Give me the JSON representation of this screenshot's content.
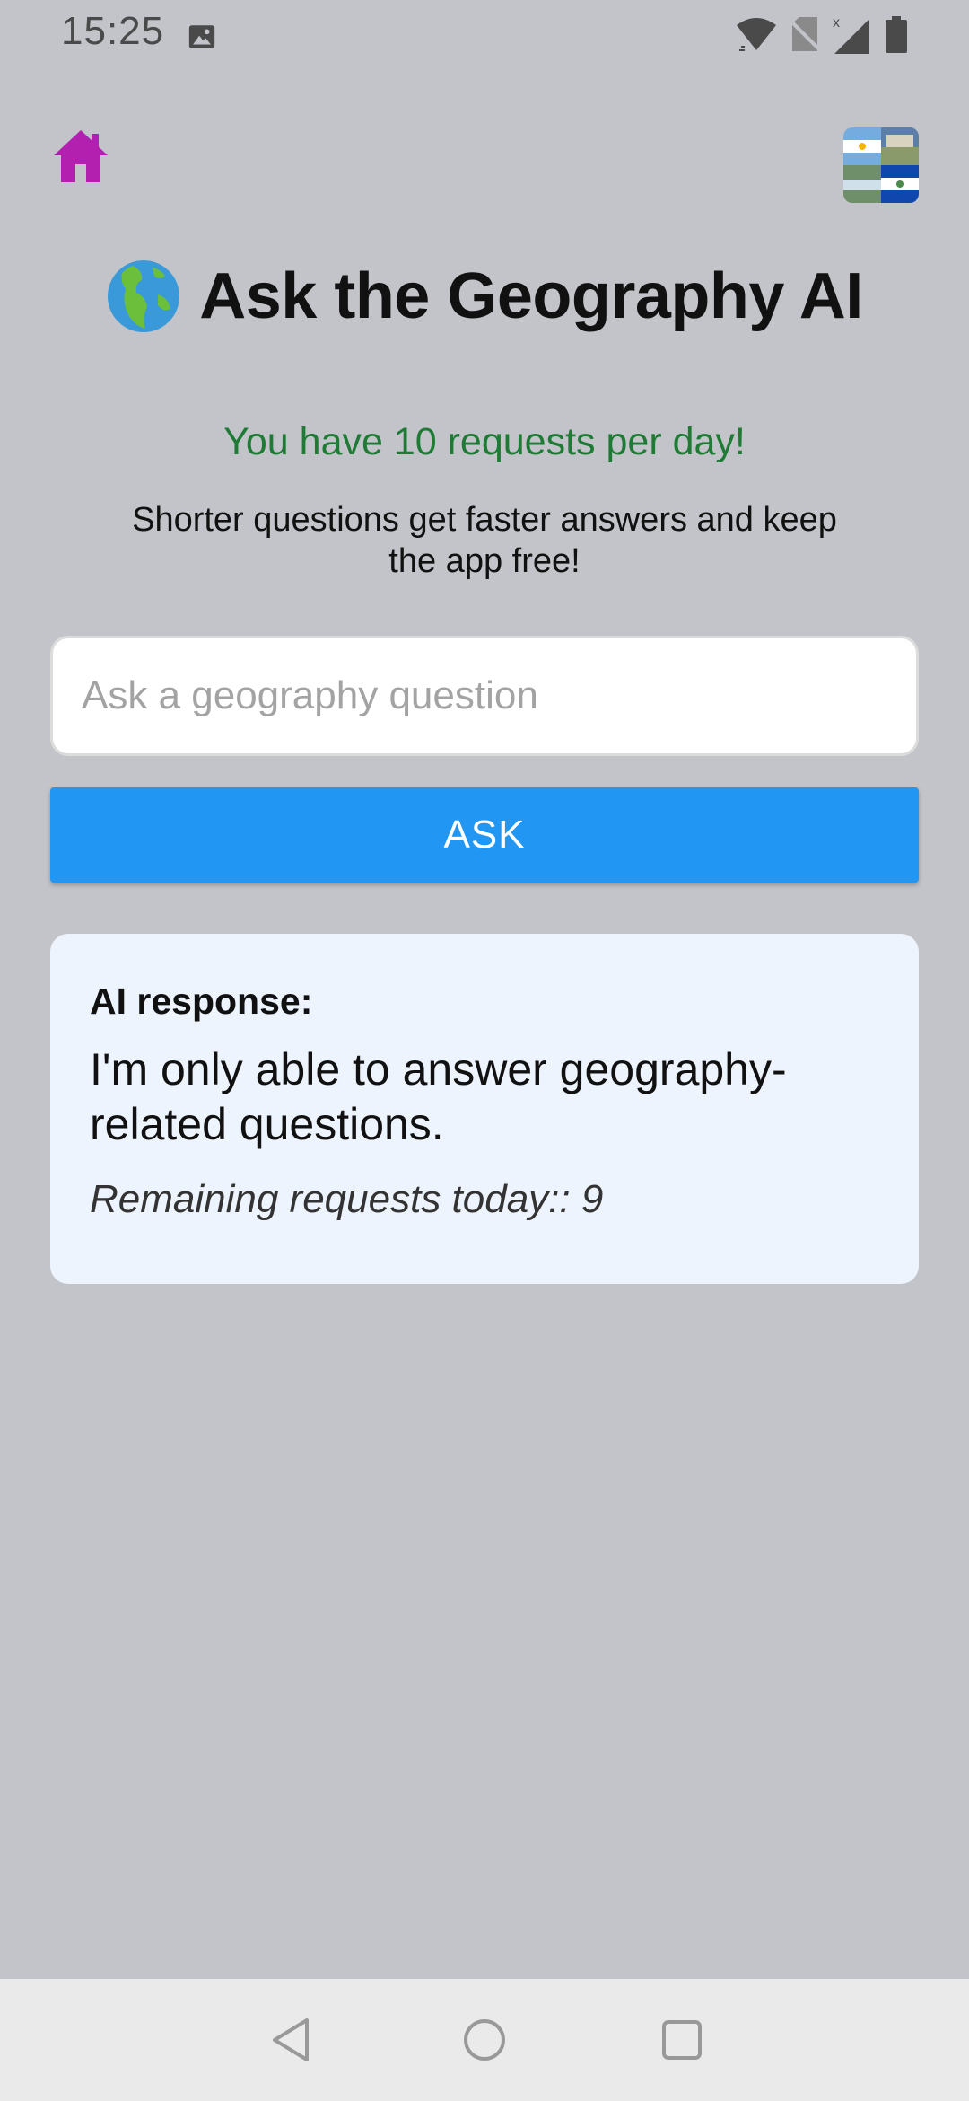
{
  "status_bar": {
    "time": "15:25",
    "icons": [
      "image-icon",
      "wifi-icon",
      "no-sim-icon",
      "signal-icon",
      "battery-icon"
    ]
  },
  "header": {
    "home_icon": "home-icon",
    "logo": "flag-collage-logo"
  },
  "title": {
    "emoji": "globe-icon",
    "text": "Ask the Geography AI"
  },
  "limit_text": "You have 10 requests per day!",
  "tip_text": "Shorter questions get faster answers and keep the app free!",
  "search": {
    "placeholder": "Ask a geography question",
    "value": ""
  },
  "ask_button_label": "ASK",
  "response": {
    "label": "AI response:",
    "text": "I'm only able to answer geography-related questions.",
    "remaining": "Remaining requests today:: 9"
  },
  "nav_bar": {
    "buttons": [
      "back-icon",
      "home-circle-icon",
      "recents-icon"
    ]
  },
  "colors": {
    "background": "#c2c4c9",
    "accent": "#2196f3",
    "home_icon": "#b320b0",
    "limit_text": "#1e7a34",
    "response_card": "#edf4fd"
  }
}
